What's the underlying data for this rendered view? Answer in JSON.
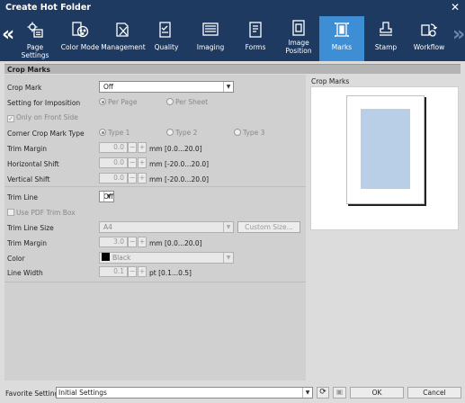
{
  "window": {
    "title": "Create Hot Folder",
    "close": "✕"
  },
  "toolbar": {
    "prev": "«",
    "next": "»",
    "tabs": [
      {
        "label": "Page Settings",
        "icon": "page-settings-icon"
      },
      {
        "label": "Color Mode",
        "icon": "color-mode-icon"
      },
      {
        "label": "Management",
        "icon": "management-icon"
      },
      {
        "label": "Quality",
        "icon": "quality-icon"
      },
      {
        "label": "Imaging",
        "icon": "imaging-icon"
      },
      {
        "label": "Forms",
        "icon": "forms-icon"
      },
      {
        "label": "Image Position",
        "icon": "image-position-icon"
      },
      {
        "label": "Marks",
        "icon": "marks-icon",
        "active": true
      },
      {
        "label": "Stamp",
        "icon": "stamp-icon"
      },
      {
        "label": "Workflow",
        "icon": "workflow-icon"
      }
    ],
    "active_color": "#3e8ed6",
    "bar_color": "#1f3a60"
  },
  "section": {
    "title": "Crop Marks"
  },
  "form": {
    "crop_mark": {
      "label": "Crop Mark",
      "value": "Off"
    },
    "imposition": {
      "label": "Setting for Imposition",
      "opt1": "Per Page",
      "opt2": "Per Sheet"
    },
    "front_side": {
      "label": "Only on Front Side",
      "checked": true
    },
    "corner_type": {
      "label": "Corner Crop Mark Type",
      "opt1": "Type 1",
      "opt2": "Type 2",
      "opt3": "Type 3"
    },
    "trim_margin": {
      "label": "Trim Margin",
      "value": "0.0",
      "minus": "−",
      "plus": "+",
      "range": "mm [0.0...20.0]"
    },
    "h_shift": {
      "label": "Horizontal Shift",
      "value": "0.0",
      "minus": "−",
      "plus": "+",
      "range": "mm [-20.0...20.0]"
    },
    "v_shift": {
      "label": "Vertical Shift",
      "value": "0.0",
      "minus": "−",
      "plus": "+",
      "range": "mm [-20.0...20.0]"
    },
    "trim_line": {
      "label": "Trim Line",
      "value": "Off"
    },
    "pdf_trim": {
      "label": "Use PDF Trim Box"
    },
    "trim_line_size": {
      "label": "Trim Line Size",
      "value": "A4",
      "custom": "Custom Size..."
    },
    "trim_margin2": {
      "label": "Trim Margin",
      "value": "3.0",
      "minus": "−",
      "plus": "+",
      "range": "mm [0.0...20.0]"
    },
    "color": {
      "label": "Color",
      "value": "Black"
    },
    "line_width": {
      "label": "Line Width",
      "value": "0.1",
      "minus": "−",
      "plus": "+",
      "range": "pt [0.1...0.5]"
    }
  },
  "preview": {
    "title": "Crop Marks",
    "page_fill": "#b9cfe8"
  },
  "bottom": {
    "favorite_label": "Favorite Setting",
    "favorite_value": "Initial Settings",
    "ok": "OK",
    "cancel": "Cancel"
  }
}
